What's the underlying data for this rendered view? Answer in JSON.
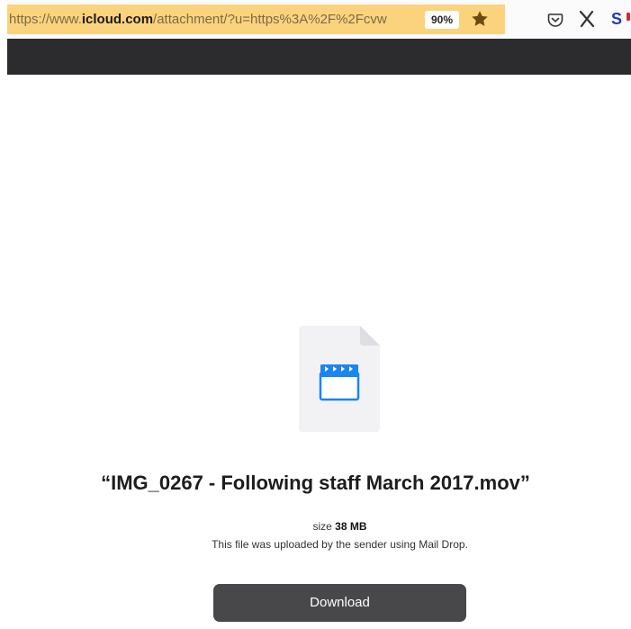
{
  "browser": {
    "url": {
      "prefix": "https://www.",
      "domain": "icloud.com",
      "rest": "/attachment/?u=https%3A%2F%2Fcvw"
    },
    "zoom_level": "90%",
    "bookmarked": true,
    "extension_s_label": "S"
  },
  "attachment": {
    "file_title": "“IMG_0267 - Following staff March 2017.mov”",
    "size_label": "size",
    "size_value": "38 MB",
    "note": "This file was uploaded by the sender using Mail Drop.",
    "download_label": "Download"
  },
  "colors": {
    "url_bar": "#fcd37d",
    "dark_header": "#2c2c2e",
    "file_icon_blue": "#1a86f0",
    "download_button": "#48484a"
  },
  "icons": {
    "bookmark": "star-icon",
    "pocket": "pocket-icon",
    "extension_x": "x-icon",
    "extension_s": "s-extension-icon",
    "file": "video-file-icon"
  }
}
